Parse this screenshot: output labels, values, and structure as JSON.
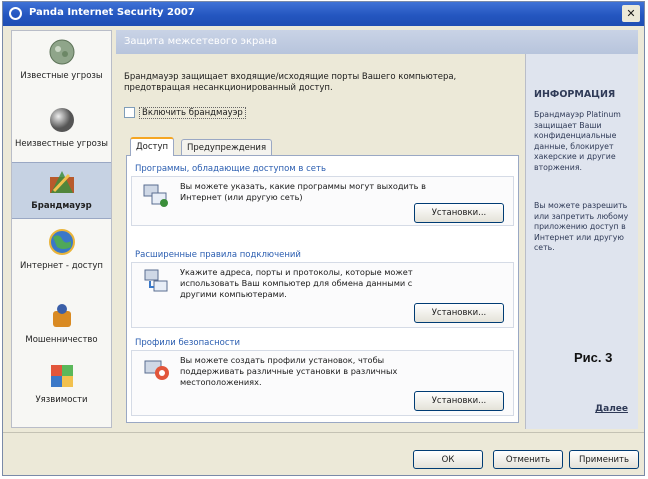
{
  "window": {
    "title": "Panda Internet Security 2007"
  },
  "sidebar": {
    "items": [
      {
        "label": "Известные угрозы",
        "icon": "virus-icon",
        "active": false
      },
      {
        "label": "Неизвестные угрозы",
        "icon": "sphere-icon",
        "active": false
      },
      {
        "label": "Брандмауэр",
        "icon": "firewall-icon",
        "active": true
      },
      {
        "label": "Интернет - доступ",
        "icon": "globe-icon",
        "active": false
      },
      {
        "label": "Мошенничество",
        "icon": "fraud-icon",
        "active": false
      },
      {
        "label": "Уязвимости",
        "icon": "vulnerability-icon",
        "active": false
      }
    ]
  },
  "header": {
    "title": "Защита межсетевого экрана"
  },
  "main": {
    "description": "Брандмауэр защищает входящие/исходящие порты Вашего компьютера, предотвращая несанкционированный доступ.",
    "enable_label": "Включить брандмауэр",
    "enable_checked": false,
    "tabs": [
      {
        "label": "Доступ",
        "active": true
      },
      {
        "label": "Предупреждения",
        "active": false
      }
    ],
    "groups": [
      {
        "title": "Программы, обладающие доступом в сеть",
        "text": "Вы можете указать, какие программы могут выходить в Интернет (или другую сеть)",
        "button": "Установки...",
        "icon": "programs-network-icon"
      },
      {
        "title": "Расширенные правила подключений",
        "text": "Укажите адреса, порты и протоколы, которые может использовать Ваш компьютер для обмена данными с другими компьютерами.",
        "button": "Установки...",
        "icon": "network-rules-icon"
      },
      {
        "title": "Профили безопасности",
        "text": "Вы можете создать профили установок, чтобы поддерживать различные установки в различных местоположениях.",
        "button": "Установки...",
        "icon": "security-profile-icon"
      }
    ]
  },
  "info": {
    "title": "ИНФОРМАЦИЯ",
    "paragraph1": "Брандмауэр Platinum защищает Ваши конфиденциальные данные, блокирует хакерские и другие вторжения.",
    "paragraph2": "Вы можете разрешить или запретить любому приложению доступ в Интернет или другую сеть.",
    "figure_label": "Рис. 3",
    "more_link": "Далее"
  },
  "footer": {
    "ok": "ОК",
    "cancel": "Отменить",
    "apply": "Применить"
  },
  "colors": {
    "titlebar": "#2456c0",
    "header": "#b7c4dc",
    "info_panel": "#dfe4ee",
    "accent": "#f5a623"
  }
}
